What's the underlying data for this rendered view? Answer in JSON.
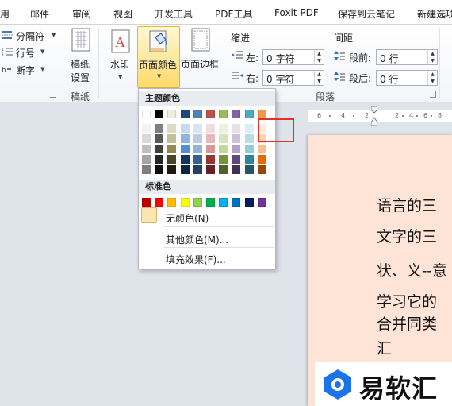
{
  "menu_tabs": [
    "用",
    "邮件",
    "审阅",
    "视图",
    "开发工具",
    "PDF工具",
    "Foxit PDF",
    "保存到云笔记",
    "新建选项"
  ],
  "ribbon": {
    "paper_group": {
      "separator_label": "分隔符",
      "line_number_label": "行号",
      "hyphenation_label": "断字",
      "manuscript_label": "稿纸",
      "manuscript_sub": "设置",
      "group_title": "稿纸"
    },
    "watermark_label": "水印",
    "page_color_label": "页面颜色",
    "page_border_label": "页面边框",
    "indent": {
      "title": "缩进",
      "left_label": "左:",
      "left_value": "0 字符",
      "right_label": "右:",
      "right_value": "0 字符"
    },
    "spacing": {
      "title": "间距",
      "before_label": "段前:",
      "before_value": "0 行",
      "after_label": "段后:",
      "after_value": "0 行"
    },
    "paragraph_group_title": "段落"
  },
  "ruler": {
    "numbers": [
      "6",
      "4",
      "2",
      "2",
      "4",
      "6",
      "8"
    ]
  },
  "color_menu": {
    "theme_title": "主题颜色",
    "standard_title": "标准色",
    "no_color_label": "无颜色(N)",
    "more_colors_label": "其他颜色(M)...",
    "fill_effects_label": "填充效果(F)...",
    "theme_top_row": [
      "#ffffff",
      "#000000",
      "#eeece1",
      "#1f497d",
      "#4f81bd",
      "#c0504d",
      "#9bbb59",
      "#8064a2",
      "#4bacc6",
      "#f79646"
    ],
    "theme_shade_columns": [
      [
        "#f2f2f2",
        "#d8d8d8",
        "#bfbfbf",
        "#a5a5a5",
        "#7f7f7f"
      ],
      [
        "#7f7f7f",
        "#595959",
        "#3f3f3f",
        "#262626",
        "#0c0c0c"
      ],
      [
        "#ddd9c3",
        "#c4bd97",
        "#938953",
        "#494429",
        "#1d1b10"
      ],
      [
        "#c6d9f0",
        "#8db3e2",
        "#548dd4",
        "#17365d",
        "#0f243e"
      ],
      [
        "#dbe5f1",
        "#b8cce4",
        "#95b3d7",
        "#366092",
        "#244061"
      ],
      [
        "#f2dcdb",
        "#e5b9b7",
        "#d99694",
        "#953734",
        "#632423"
      ],
      [
        "#ebf1dd",
        "#d7e3bc",
        "#c3d69b",
        "#76923c",
        "#4f6128"
      ],
      [
        "#e5e0ec",
        "#ccc1d9",
        "#b2a2c7",
        "#5f497a",
        "#3f3151"
      ],
      [
        "#dbeef3",
        "#b7dde8",
        "#92cddc",
        "#31859b",
        "#205867"
      ],
      [
        "#fdeada",
        "#fbd5b5",
        "#fac08f",
        "#e36c09",
        "#974806"
      ]
    ],
    "standard_colors": [
      "#c00000",
      "#ff0000",
      "#ffc000",
      "#ffff00",
      "#92d050",
      "#00b050",
      "#00b0f0",
      "#0070c0",
      "#002060",
      "#7030a0"
    ],
    "no_color_swatch": "#fbe6b3",
    "highlight_color": "#e53323"
  },
  "document": {
    "page_color": "#fde4d6",
    "lines": [
      "语言的三",
      "文字的三",
      "状、义--意",
      "学习它的",
      "合并同类",
      "汇"
    ]
  },
  "watermark": {
    "text": "易软汇",
    "logo_color": "#1a73e8"
  }
}
